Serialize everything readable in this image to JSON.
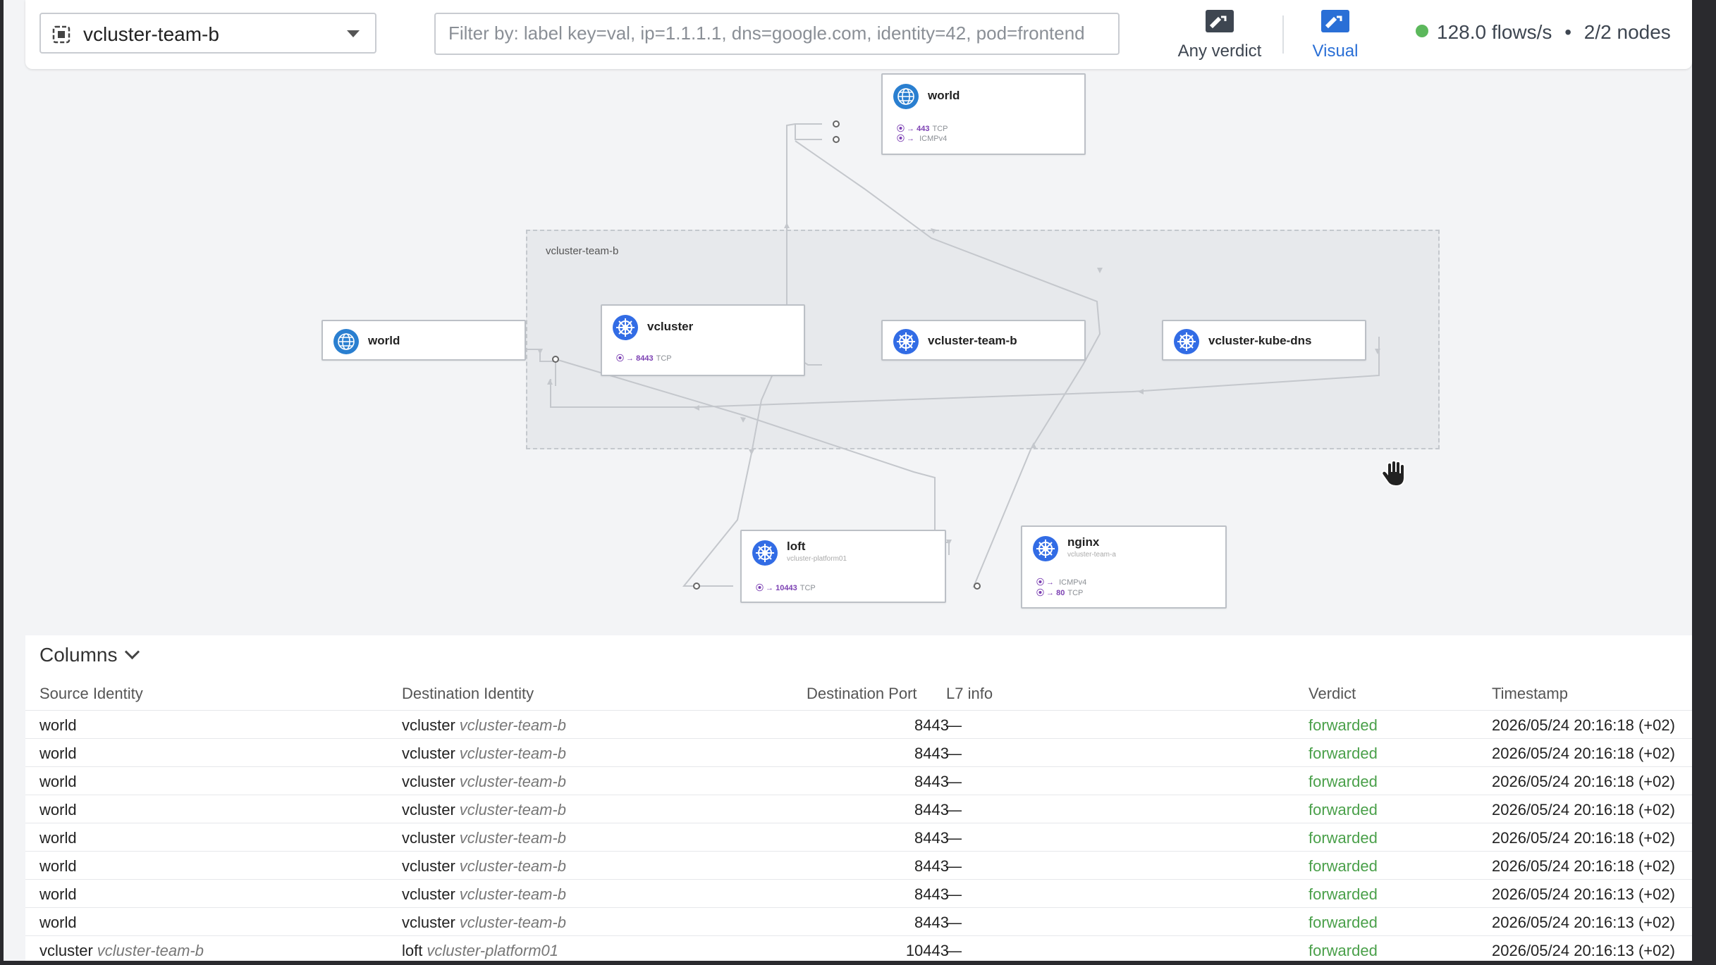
{
  "header": {
    "namespace": "vcluster-team-b",
    "filter_placeholder": "Filter by: label key=val, ip=1.1.1.1, dns=google.com, identity=42, pod=frontend",
    "verdict_label": "Any verdict",
    "visual_label": "Visual",
    "flows_rate": "128.0 flows/s",
    "separator": "•",
    "nodes": "2/2 nodes"
  },
  "graph": {
    "namespace_box_label": "vcluster-team-b",
    "nodes": {
      "world_top": {
        "name": "world",
        "ports": [
          {
            "port": "443",
            "proto": "TCP"
          },
          {
            "port": "",
            "proto": "ICMPv4"
          }
        ]
      },
      "world_left": {
        "name": "world"
      },
      "vcluster": {
        "name": "vcluster",
        "ports": [
          {
            "port": "8443",
            "proto": "TCP"
          }
        ]
      },
      "vcluster_team_b": {
        "name": "vcluster-team-b"
      },
      "vcluster_kube_dns": {
        "name": "vcluster-kube-dns"
      },
      "loft": {
        "name": "loft",
        "namespace": "vcluster-platform01",
        "ports": [
          {
            "port": "10443",
            "proto": "TCP"
          }
        ]
      },
      "nginx": {
        "name": "nginx",
        "namespace": "vcluster-team-a",
        "ports": [
          {
            "port": "",
            "proto": "ICMPv4"
          },
          {
            "port": "80",
            "proto": "TCP"
          }
        ]
      }
    }
  },
  "table": {
    "columns_label": "Columns",
    "headers": {
      "source": "Source Identity",
      "destination": "Destination Identity",
      "port": "Destination Port",
      "l7": "L7 info",
      "verdict": "Verdict",
      "timestamp": "Timestamp"
    },
    "rows": [
      {
        "src": "world",
        "src_ns": "",
        "dst": "vcluster",
        "dst_ns": "vcluster-team-b",
        "port": "8443",
        "l7": "—",
        "verdict": "forwarded",
        "ts": "2026/05/24 20:16:18 (+02)"
      },
      {
        "src": "world",
        "src_ns": "",
        "dst": "vcluster",
        "dst_ns": "vcluster-team-b",
        "port": "8443",
        "l7": "—",
        "verdict": "forwarded",
        "ts": "2026/05/24 20:16:18 (+02)"
      },
      {
        "src": "world",
        "src_ns": "",
        "dst": "vcluster",
        "dst_ns": "vcluster-team-b",
        "port": "8443",
        "l7": "—",
        "verdict": "forwarded",
        "ts": "2026/05/24 20:16:18 (+02)"
      },
      {
        "src": "world",
        "src_ns": "",
        "dst": "vcluster",
        "dst_ns": "vcluster-team-b",
        "port": "8443",
        "l7": "—",
        "verdict": "forwarded",
        "ts": "2026/05/24 20:16:18 (+02)"
      },
      {
        "src": "world",
        "src_ns": "",
        "dst": "vcluster",
        "dst_ns": "vcluster-team-b",
        "port": "8443",
        "l7": "—",
        "verdict": "forwarded",
        "ts": "2026/05/24 20:16:18 (+02)"
      },
      {
        "src": "world",
        "src_ns": "",
        "dst": "vcluster",
        "dst_ns": "vcluster-team-b",
        "port": "8443",
        "l7": "—",
        "verdict": "forwarded",
        "ts": "2026/05/24 20:16:18 (+02)"
      },
      {
        "src": "world",
        "src_ns": "",
        "dst": "vcluster",
        "dst_ns": "vcluster-team-b",
        "port": "8443",
        "l7": "—",
        "verdict": "forwarded",
        "ts": "2026/05/24 20:16:13 (+02)"
      },
      {
        "src": "world",
        "src_ns": "",
        "dst": "vcluster",
        "dst_ns": "vcluster-team-b",
        "port": "8443",
        "l7": "—",
        "verdict": "forwarded",
        "ts": "2026/05/24 20:16:13 (+02)"
      },
      {
        "src": "vcluster",
        "src_ns": "vcluster-team-b",
        "dst": "loft",
        "dst_ns": "vcluster-platform01",
        "port": "10443",
        "l7": "—",
        "verdict": "forwarded",
        "ts": "2026/05/24 20:16:13 (+02)"
      }
    ]
  },
  "colors": {
    "accent": "#2a6fd6",
    "forwarded": "#4aa04a",
    "port": "#7b3fb2",
    "status_ok": "#5cb85c"
  }
}
